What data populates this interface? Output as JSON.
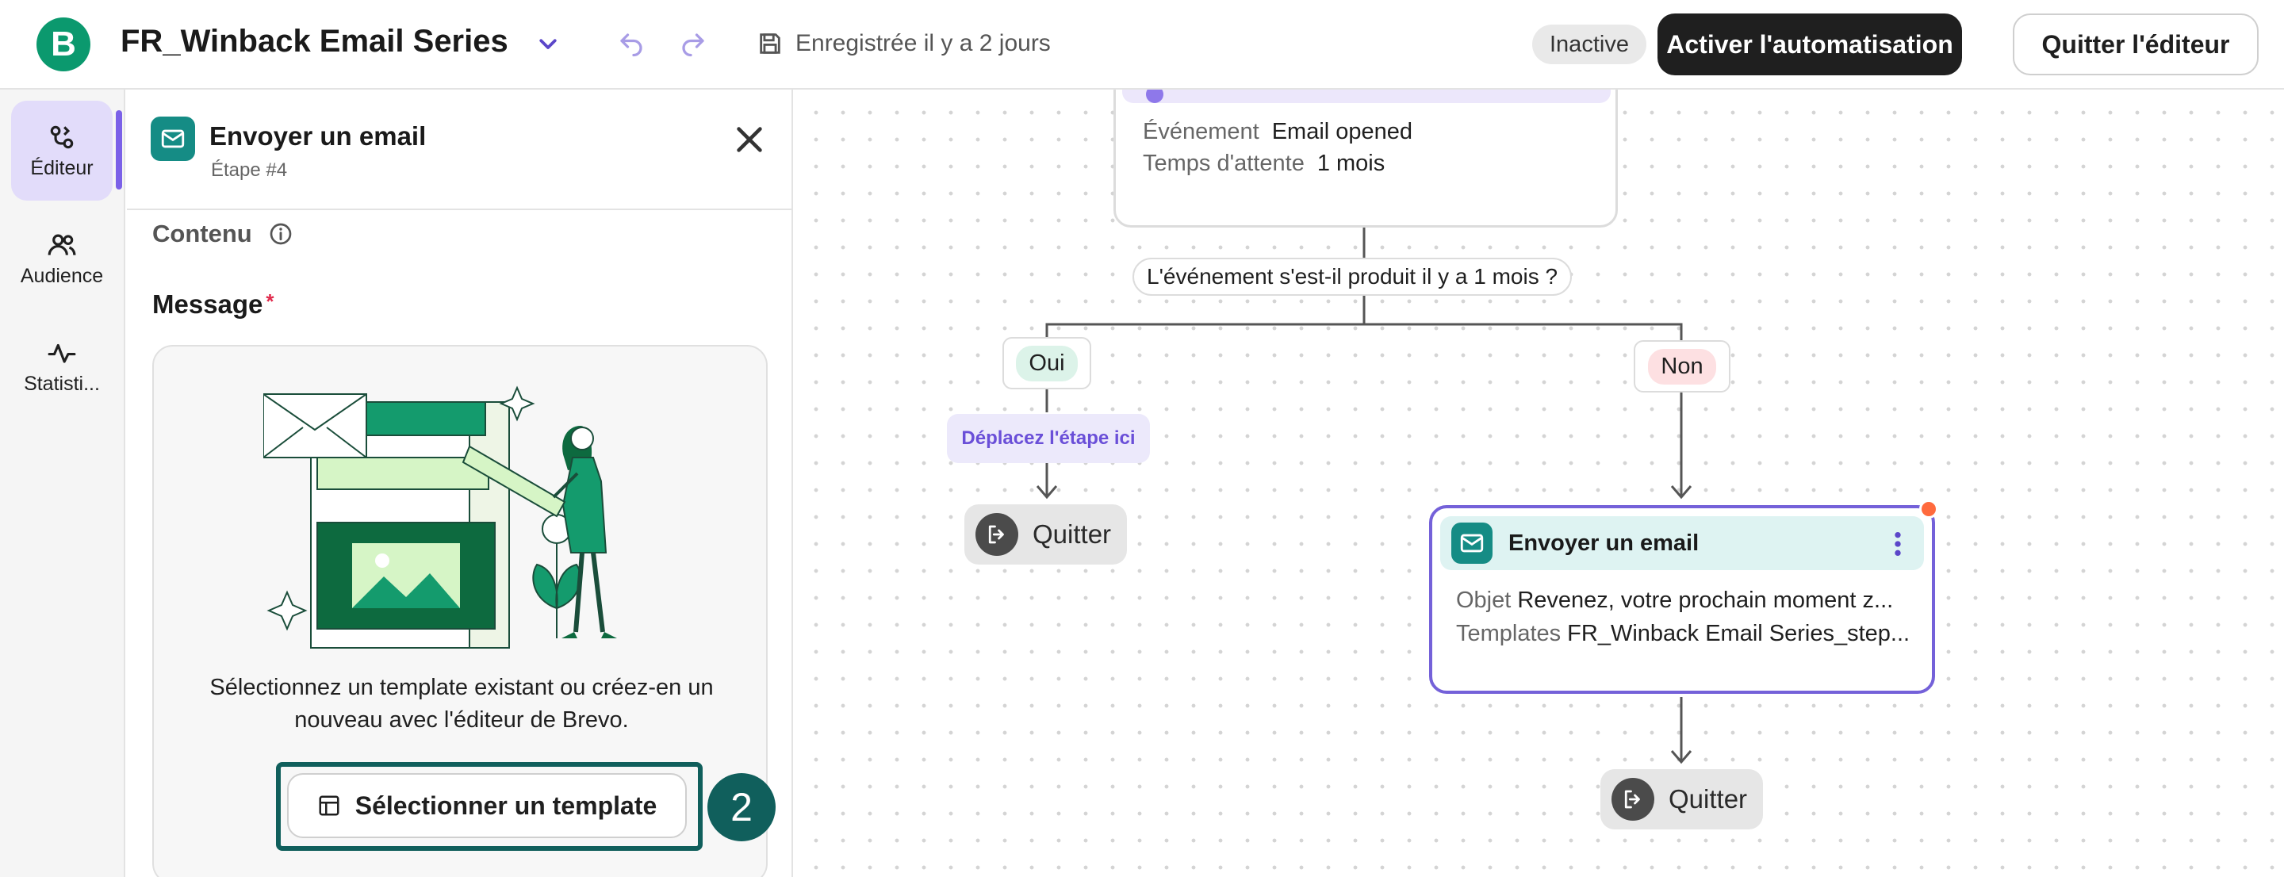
{
  "topbar": {
    "logo_letter": "B",
    "title": "FR_Winback Email Series",
    "saved_text": "Enregistrée il y a 2 jours",
    "status_badge": "Inactive",
    "activate_label": "Activer l'automatisation",
    "quit_label": "Quitter l'éditeur"
  },
  "leftnav": {
    "items": [
      {
        "label": "Éditeur",
        "icon": "editor-icon",
        "active": true
      },
      {
        "label": "Audience",
        "icon": "audience-icon",
        "active": false
      },
      {
        "label": "Statisti...",
        "icon": "statistics-icon",
        "active": false
      }
    ]
  },
  "panel": {
    "title": "Envoyer un email",
    "step": "Étape #4",
    "section_label": "Contenu",
    "message_label": "Message",
    "required_mark": "*",
    "card_text": "Sélectionnez un template existant ou créez-en un nouveau avec l'éditeur de Brevo.",
    "select_template_label": "Sélectionner un template",
    "step_number": "2"
  },
  "canvas": {
    "top_node": {
      "event_key": "Événement",
      "event_value": "Email opened",
      "wait_key": "Temps d'attente",
      "wait_value": "1 mois"
    },
    "question": "L'événement s'est-il produit il y a 1 mois ?",
    "branch_yes": "Oui",
    "branch_no": "Non",
    "move_here": "Déplacez l'étape ici",
    "quit_left": "Quitter",
    "quit_right": "Quitter",
    "email_node": {
      "title": "Envoyer un email",
      "subject_key": "Objet",
      "subject_value": "Revenez, votre prochain moment z...",
      "templates_key": "Templates",
      "templates_value": "FR_Winback Email Series_step..."
    }
  },
  "colors": {
    "brand_green": "#0b996e",
    "teal": "#158c85",
    "accent_purple": "#7461d9",
    "dark_button": "#1f1f1f",
    "notification_dot": "#ff6a3d"
  }
}
